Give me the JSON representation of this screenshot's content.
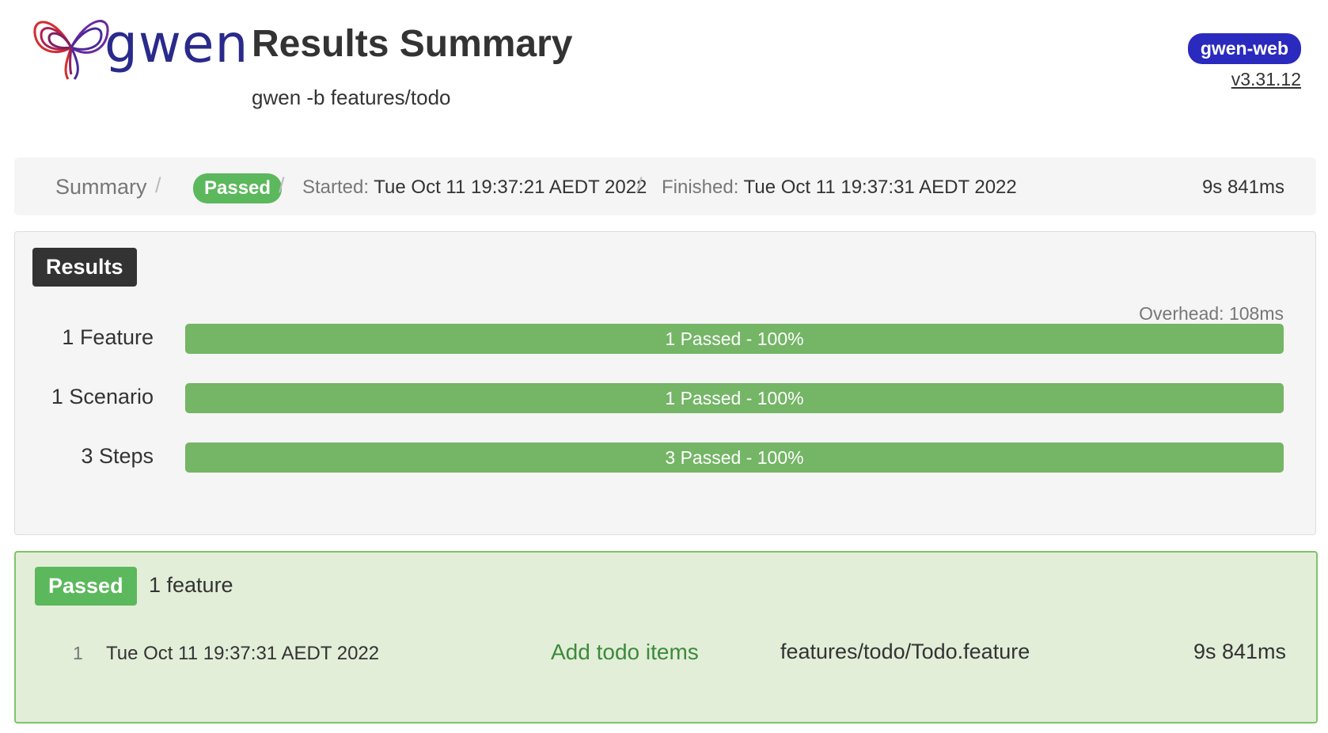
{
  "header": {
    "logo_text": "gwen",
    "title": "Results Summary",
    "subtitle": "gwen -b features/todo",
    "brand_badge": "gwen-web",
    "version": "v3.31.12"
  },
  "breadcrumb": {
    "summary_label": "Summary",
    "separator": "/",
    "status": "Passed",
    "started_label": "Started:",
    "started_value": "Tue Oct 11 19:37:21 AEDT 2022",
    "finished_label": "Finished:",
    "finished_value": "Tue Oct 11 19:37:31 AEDT 2022",
    "duration": "9s 841ms"
  },
  "results": {
    "label": "Results",
    "overhead": "Overhead: 108ms",
    "rows": [
      {
        "count_label": "1 Feature",
        "bar_text": "1 Passed - 100%",
        "passed_percent": 100
      },
      {
        "count_label": "1 Scenario",
        "bar_text": "1 Passed - 100%",
        "passed_percent": 100
      },
      {
        "count_label": "3 Steps",
        "bar_text": "3 Passed - 100%",
        "passed_percent": 100
      }
    ]
  },
  "passed_features": {
    "label": "Passed",
    "count": "1 feature",
    "items": [
      {
        "index": "1",
        "date": "Tue Oct 11 19:37:31 AEDT 2022",
        "name": "Add todo items",
        "file": "features/todo/Todo.feature",
        "duration": "9s 841ms"
      }
    ]
  },
  "colors": {
    "passed_green": "#5cb85c",
    "bar_green": "#74b566",
    "panel_green": "#e2eed8",
    "brand_blue": "#2a2abf"
  }
}
